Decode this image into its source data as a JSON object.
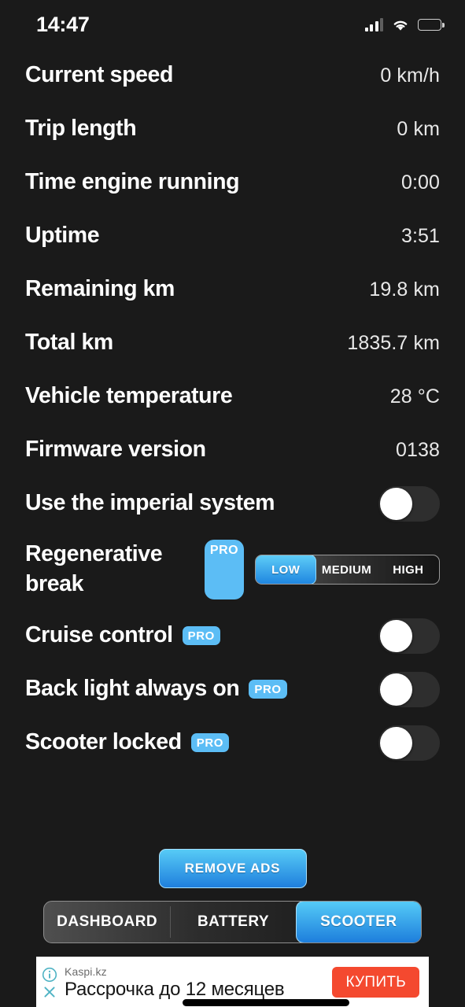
{
  "status_bar": {
    "time": "14:47",
    "signal_icon": "signal-bars-icon",
    "wifi_icon": "wifi-icon",
    "battery_icon": "battery-low-icon",
    "battery_color": "#f5cb2e"
  },
  "theme": {
    "background": "#1a1a1a",
    "text": "#ffffff",
    "accent_blue": "#2e9ae8",
    "pro_badge": "#5cbdf5",
    "ad_cta_red": "#f4492f"
  },
  "rows": [
    {
      "label": "Current speed",
      "value": "0 km/h",
      "type": "value"
    },
    {
      "label": "Trip length",
      "value": "0 km",
      "type": "value"
    },
    {
      "label": "Time engine running",
      "value": "0:00",
      "type": "value"
    },
    {
      "label": "Uptime",
      "value": "3:51",
      "type": "value"
    },
    {
      "label": "Remaining km",
      "value": "19.8 km",
      "type": "value"
    },
    {
      "label": "Total km",
      "value": "1835.7 km",
      "type": "value"
    },
    {
      "label": "Vehicle temperature",
      "value": "28 °C",
      "type": "value"
    },
    {
      "label": "Firmware version",
      "value": "0138",
      "type": "value"
    },
    {
      "label": "Use the imperial system",
      "type": "toggle",
      "state": "off"
    },
    {
      "label": "Regenerative break",
      "type": "segmented",
      "badge": "PRO",
      "options": [
        "LOW",
        "MEDIUM",
        "HIGH"
      ],
      "selected": "LOW"
    },
    {
      "label": "Cruise control",
      "type": "toggle",
      "badge": "PRO",
      "state": "off"
    },
    {
      "label": "Back light always on",
      "type": "toggle",
      "badge": "PRO",
      "state": "off"
    },
    {
      "label": "Scooter locked",
      "type": "toggle",
      "badge": "PRO",
      "state": "off"
    }
  ],
  "footer": {
    "remove_ads_label": "REMOVE ADS",
    "tabs": [
      {
        "label": "DASHBOARD",
        "active": false
      },
      {
        "label": "BATTERY",
        "active": false
      },
      {
        "label": "SCOOTER",
        "active": true
      }
    ]
  },
  "ad": {
    "brand": "Kaspi.kz",
    "text": "Рассрочка до 12 месяцев",
    "cta_label": "КУПИТЬ",
    "info_icon": "info-circle-icon",
    "close_icon": "close-x-icon"
  }
}
